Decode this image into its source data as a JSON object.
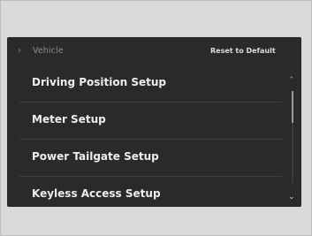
{
  "header": {
    "back_icon": "chevron-right",
    "title": "Vehicle",
    "reset_label": "Reset to Default"
  },
  "menu": {
    "items": [
      {
        "label": "Driving Position Setup"
      },
      {
        "label": "Meter Setup"
      },
      {
        "label": "Power Tailgate Setup"
      },
      {
        "label": "Keyless Access Setup"
      }
    ]
  },
  "scrollbar": {
    "up_icon": "chevron-up",
    "down_icon": "chevron-down",
    "position": 0.0
  },
  "colors": {
    "screen_bg": "#2a2a2a",
    "text": "#ededed",
    "muted": "#8c8c8c"
  }
}
